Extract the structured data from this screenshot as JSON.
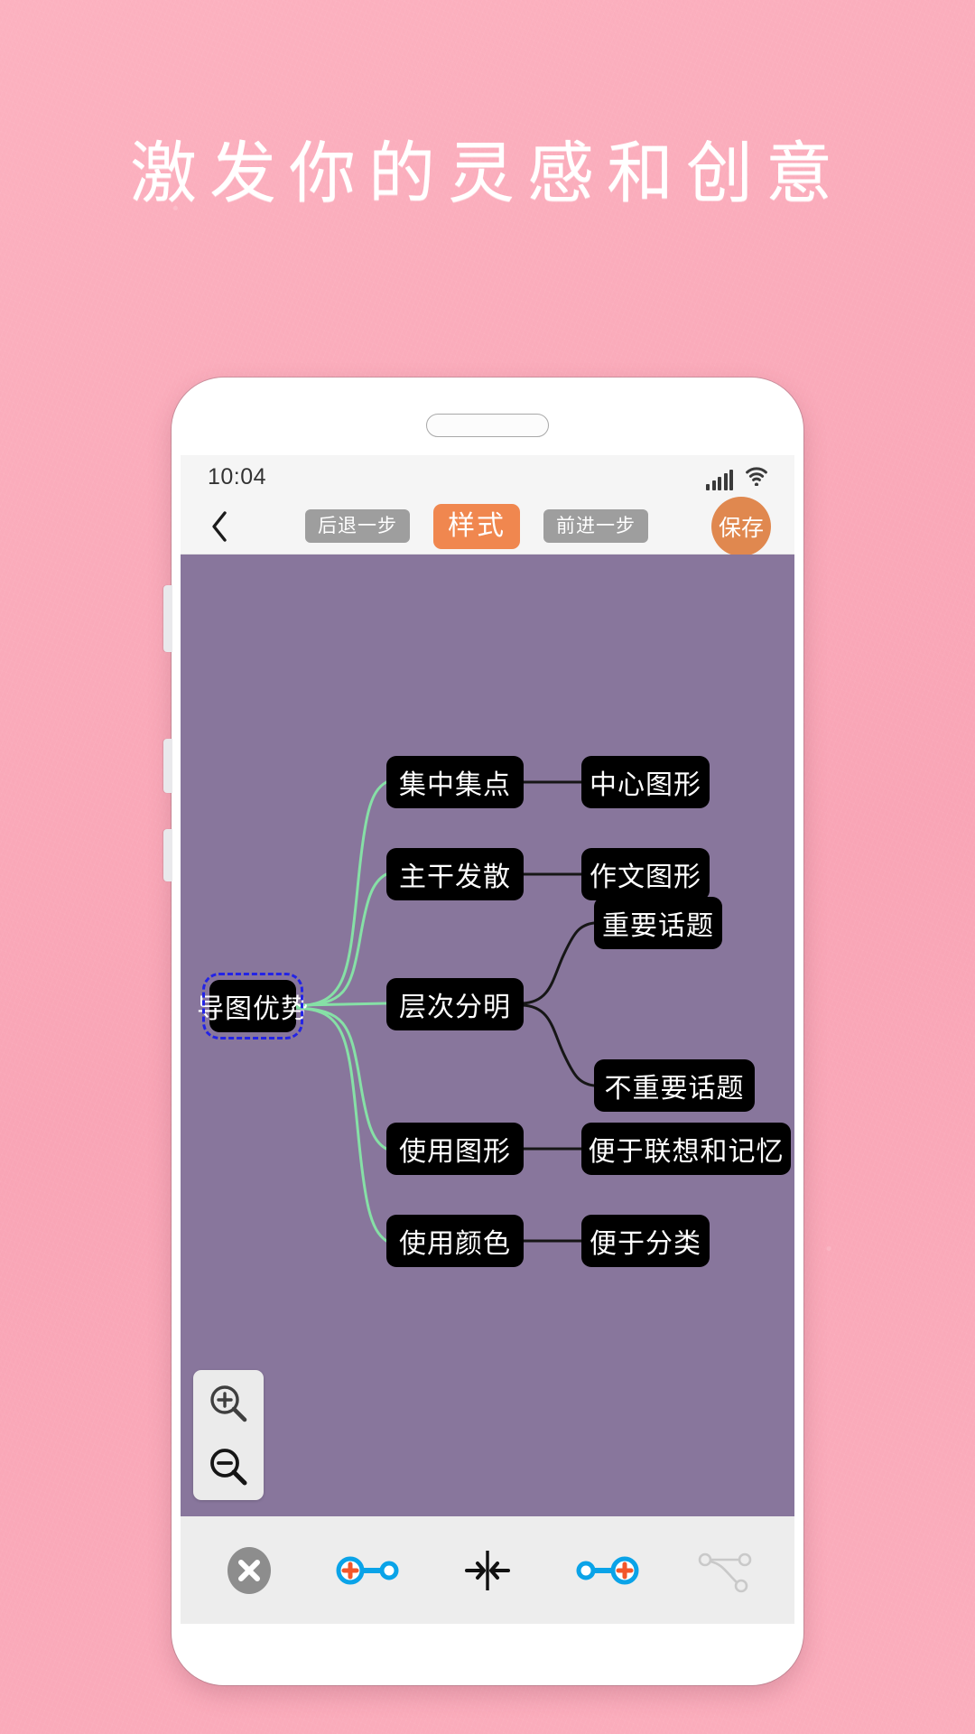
{
  "promo": {
    "headline": "激发你的灵感和创意",
    "background_color": "#fbadbd",
    "headline_color": "#ffffff"
  },
  "phone": {
    "frame_color": "#ffffff",
    "speaker_name": "speaker-pill",
    "side_buttons": [
      "volume-up",
      "volume-down",
      "power"
    ]
  },
  "status_bar": {
    "time": "10:04",
    "signal_icon": "signal-bars-icon",
    "wifi_icon": "wifi-icon"
  },
  "toolbar": {
    "back_icon": "chevron-left-icon",
    "undo_label": "后退一步",
    "style_label": "样式",
    "redo_label": "前进一步",
    "save_label": "保存",
    "undo_bg": "#9e9e9e",
    "redo_bg": "#9e9e9e",
    "style_bg": "#f0874f",
    "save_bg": "#e0884f"
  },
  "canvas": {
    "background_color": "#88769c",
    "root_link_color": "#86e0a6",
    "child_link_color": "#161616",
    "selection_color": "#2323e6",
    "node_bg": "#000000",
    "node_text_color": "#ffffff"
  },
  "mindmap": {
    "type": "tree",
    "root": {
      "label": "导图优势",
      "selected": true
    },
    "branches": [
      {
        "label": "集中集点",
        "children": [
          {
            "label": "中心图形"
          }
        ]
      },
      {
        "label": "主干发散",
        "children": [
          {
            "label": "作文图形"
          }
        ]
      },
      {
        "label": "层次分明",
        "children": [
          {
            "label": "重要话题"
          },
          {
            "label": "不重要话题"
          }
        ]
      },
      {
        "label": "使用图形",
        "children": [
          {
            "label": "便于联想和记忆"
          }
        ]
      },
      {
        "label": "使用颜色",
        "children": [
          {
            "label": "便于分类"
          }
        ]
      }
    ]
  },
  "nodes": {
    "root": "导图优势",
    "b0": "集中集点",
    "b0c0": "中心图形",
    "b1": "主干发散",
    "b1c0": "作文图形",
    "b2": "层次分明",
    "b2c0": "重要话题",
    "b2c1": "不重要话题",
    "b3": "使用图形",
    "b3c0": "便于联想和记忆",
    "b4": "使用颜色",
    "b4c0": "便于分类"
  },
  "zoom_controls": {
    "zoom_in_icon": "magnifier-plus-icon",
    "zoom_out_icon": "magnifier-minus-icon"
  },
  "bottom_bar": {
    "items": [
      {
        "icon": "delete-node-icon",
        "label": ""
      },
      {
        "icon": "add-sibling-before-icon",
        "label": ""
      },
      {
        "icon": "collapse-node-icon",
        "label": ""
      },
      {
        "icon": "add-sibling-after-icon",
        "label": ""
      },
      {
        "icon": "add-relation-icon",
        "label": ""
      }
    ],
    "accent_blue": "#0aa3e8",
    "accent_orange": "#f2562a",
    "disabled_gray": "#8d8d8d"
  }
}
